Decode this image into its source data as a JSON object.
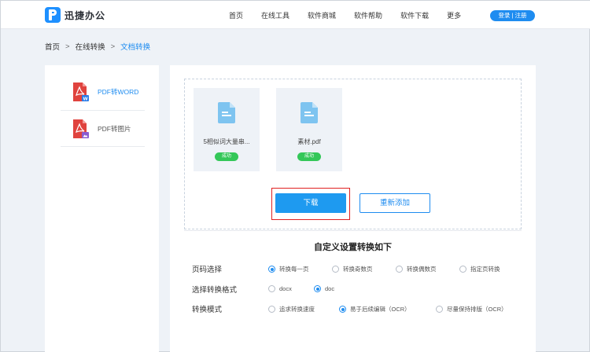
{
  "header": {
    "brand": "迅捷办公",
    "nav": [
      "首页",
      "在线工具",
      "软件商城",
      "软件帮助",
      "软件下载",
      "更多"
    ],
    "login_label": "登录 | 注册"
  },
  "breadcrumb": {
    "home": "首页",
    "sep1": ">",
    "section": "在线转换",
    "sep2": ">",
    "current": "文档转换"
  },
  "sidebar": {
    "items": [
      {
        "label": "PDF转WORD",
        "icon": "pdf-word-icon",
        "active": true
      },
      {
        "label": "PDF转图片",
        "icon": "pdf-image-icon",
        "active": false
      }
    ]
  },
  "files": [
    {
      "name": "5相似词大量串...",
      "status": "成功"
    },
    {
      "name": "素材.pdf",
      "status": "成功"
    }
  ],
  "actions": {
    "download": "下载",
    "readd": "重新添加"
  },
  "settings": {
    "title": "自定义设置转换如下",
    "rows": [
      {
        "label": "页码选择",
        "options": [
          "转换每一页",
          "转换奇数页",
          "转换偶数页",
          "指定页转换"
        ],
        "selected": 0
      },
      {
        "label": "选择转换格式",
        "options": [
          "docx",
          "doc"
        ],
        "selected": 1
      },
      {
        "label": "转换模式",
        "options": [
          "追求转换速度",
          "易于后续编辑（OCR）",
          "尽量保持排版（OCR）"
        ],
        "selected": 1
      }
    ]
  },
  "colors": {
    "accent": "#1e8cf0",
    "success": "#34c759",
    "highlight": "#e02020",
    "pdf_red": "#e0433e",
    "pdf_purple": "#8a5cd0"
  }
}
